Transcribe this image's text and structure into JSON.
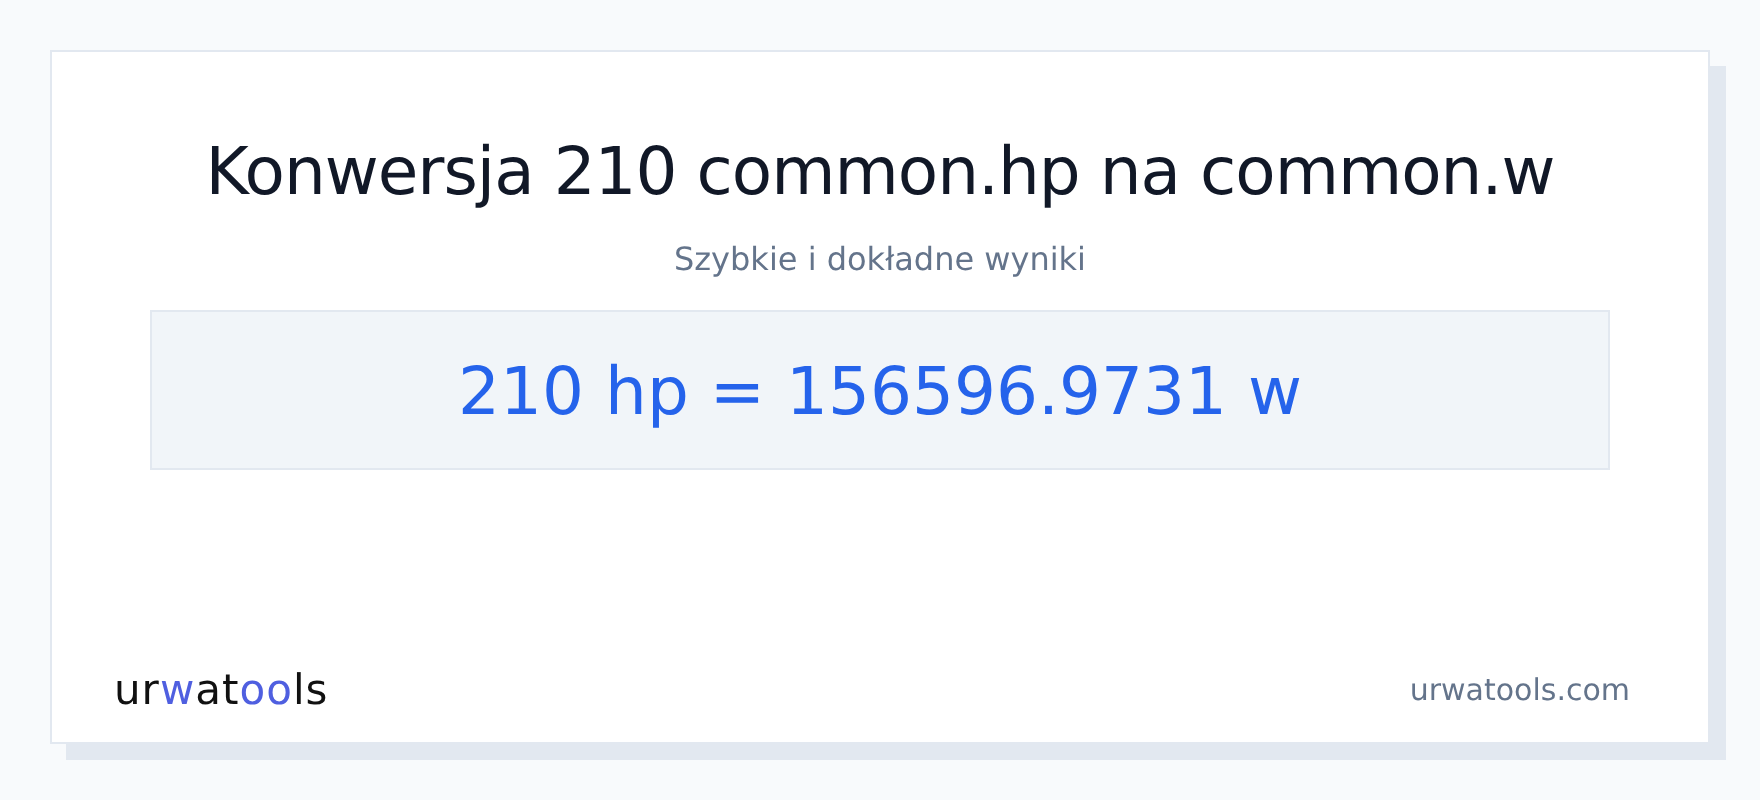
{
  "title": "Konwersja 210 common.hp na common.w",
  "subtitle": "Szybkie i dokładne wyniki",
  "result": "210 hp = 156596.9731 w",
  "logo": [
    {
      "text": "ur",
      "accent": false
    },
    {
      "text": "w",
      "accent": true
    },
    {
      "text": "at",
      "accent": false
    },
    {
      "text": "oo",
      "accent": true
    },
    {
      "text": "ls",
      "accent": false
    }
  ],
  "site": "urwatools.com"
}
